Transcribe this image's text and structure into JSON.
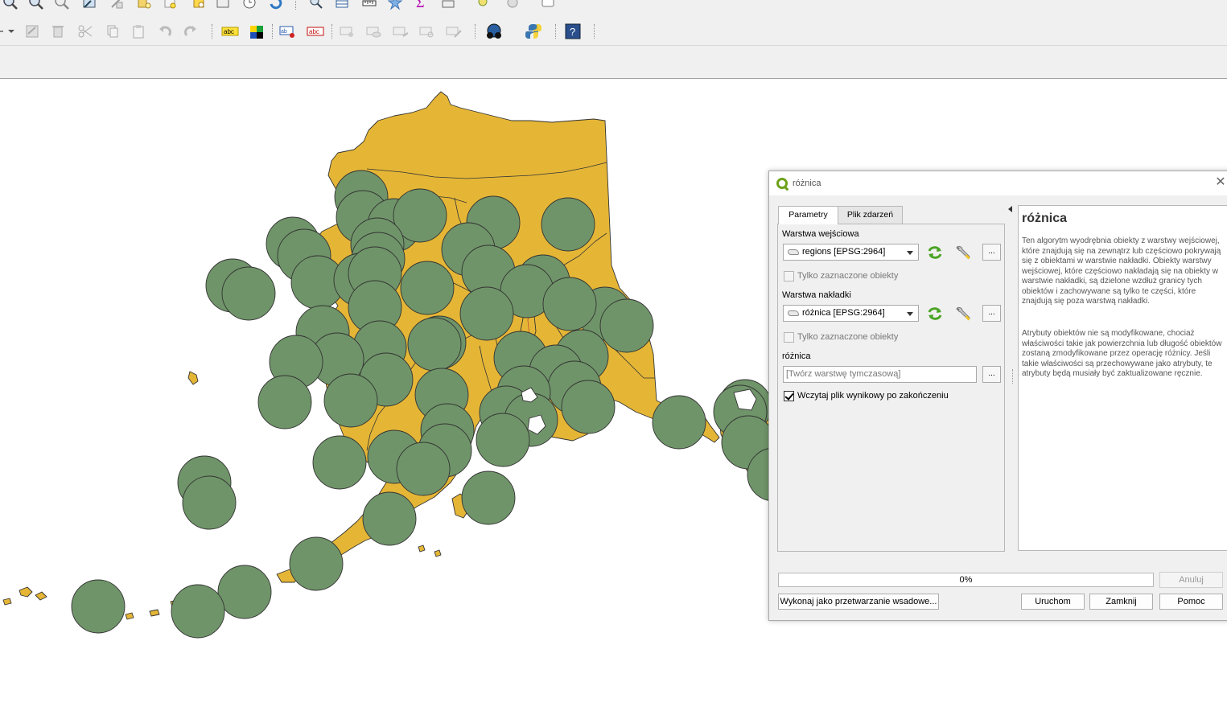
{
  "toolbar": {
    "row1_icons": [
      "zoom-in-icon",
      "zoom-out-icon",
      "zoom-icon",
      "zoom-full-icon",
      "zoom-layer-icon",
      "zoom-selection-icon",
      "new-map-icon",
      "bookmark-icon",
      "temporal-icon",
      "refresh-icon",
      "identify-icon",
      "attribute-table-icon",
      "measure-icon",
      "star-icon",
      "text-annotation-icon",
      "statistics-icon",
      "select-icon",
      "pan-icon",
      "tips-icon"
    ],
    "row2_icons": [
      "edit-dropdown-icon",
      "save-edits-icon",
      "delete-icon",
      "cut-icon",
      "copy-icon",
      "paste-icon",
      "undo-icon",
      "redo-icon",
      "label-abc-yellow-icon",
      "diagram-icon",
      "label-pin-icon",
      "label-abc-red-icon",
      "label-move-icon",
      "label-show-icon",
      "label-rotate-icon",
      "label-change-icon",
      "label-edit-icon",
      "plugin-globe-icon",
      "python-icon",
      "help-icon"
    ]
  },
  "map": {
    "land_color": "#e5b636",
    "buffer_color": "#6f9469",
    "outline_color": "#333333"
  },
  "dialog": {
    "title": "różnica",
    "tabs": [
      "Parametry",
      "Plik zdarzeń"
    ],
    "input_layer_label": "Warstwa wejściowa",
    "input_layer_value": "regions [EPSG:2964]",
    "input_selected_only": "Tylko zaznaczone obiekty",
    "overlay_layer_label": "Warstwa nakładki",
    "overlay_layer_value": "różnica [EPSG:2964]",
    "overlay_selected_only": "Tylko zaznaczone obiekty",
    "output_label": "różnica",
    "output_placeholder": "[Twórz warstwę tymczasową]",
    "open_output_label": "Wczytaj plik wynikowy po zakończeniu",
    "open_output_checked": true,
    "dots_label": "...",
    "help": {
      "title": "różnica",
      "p1": "Ten algorytm wyodrębnia obiekty z warstwy wejściowej, które znajdują się na zewnątrz lub częściowo pokrywają się z obiektami w warstwie nakładki. Obiekty warstwy wejściowej, które częściowo nakładają się na obiekty w warstwie nakładki, są dzielone wzdłuż granicy tych obiektów i zachowywane są tylko te części, które znajdują się poza warstwą nakładki.",
      "p2": "Atrybuty obiektów nie są modyfikowane, chociaż właściwości takie jak powierzchnia lub długość obiektów zostaną zmodyfikowane przez operację różnicy. Jeśli takie właściwości są przechowywane jako atrybuty, te atrybuty będą musiały być zaktualizowane ręcznie."
    },
    "progress_text": "0%",
    "progress_value": 0,
    "buttons": {
      "cancel": "Anuluj",
      "batch": "Wykonaj jako przetwarzanie wsadowe...",
      "run": "Uruchom",
      "close": "Zamknij",
      "help": "Pomoc"
    }
  }
}
